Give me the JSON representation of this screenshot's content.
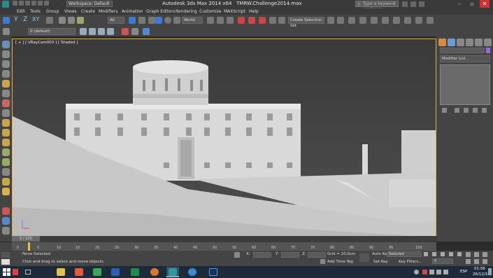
{
  "titlebar": {
    "app_title": "Autodesk 3ds Max  2014 x64",
    "file_name": "TMRW.Challenge2014.max",
    "workspace": "Workspace: Default",
    "search_placeholder": "Type a keyword or phrase"
  },
  "menu": [
    "Edit",
    "Tools",
    "Group",
    "Views",
    "Create",
    "Modifiers",
    "Animation",
    "Graph Editors",
    "Rendering",
    "Customize",
    "MAXScript",
    "Help"
  ],
  "toolbar": {
    "selection_filter": "All",
    "ref_coord": "World",
    "named_selection": "Create Selection Set",
    "layer": "0 (default)"
  },
  "viewport": {
    "label": "[ + ] [ VRayCam003 ] [ Shaded ]"
  },
  "command_panel": {
    "modifier_list": "Modifier List"
  },
  "timeline": {
    "frame_label": "0 / 100",
    "ticks": [
      "0",
      "5",
      "10",
      "15",
      "20",
      "25",
      "30",
      "35",
      "40",
      "45",
      "50",
      "55",
      "60",
      "65",
      "70",
      "75",
      "80",
      "85",
      "90",
      "95",
      "100"
    ]
  },
  "status": {
    "selection": "None Selected",
    "prompt": "Click and drag to select and move objects",
    "x_label": "X:",
    "y_label": "Y:",
    "z_label": "Z:",
    "grid": "Grid = 10,0cm",
    "add_time_tag": "Add Time Tag",
    "auto_key": "Auto Key",
    "set_key": "Set Key",
    "key_filters": "Key Filters...",
    "key_mode": "Selected",
    "frame_value": "0"
  },
  "taskbar": {
    "lang": "ESP",
    "time": "01:56",
    "date": "26/12/18"
  }
}
